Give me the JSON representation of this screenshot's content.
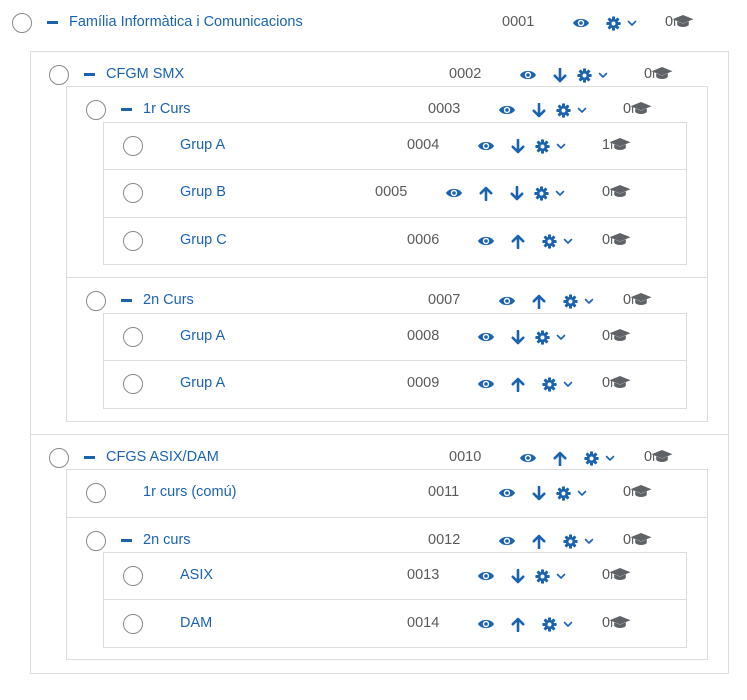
{
  "colors": {
    "accent": "#1a63b0",
    "muted_icon": "#5f6368",
    "border": "#dcdcdc"
  },
  "rows": [
    {
      "name": "Família Informàtica i Comunicacions",
      "code": "0001",
      "count": "0",
      "toggle": "collapse",
      "actions": [
        "eye-icon",
        "gear-icon",
        "chevron-down-icon"
      ]
    },
    {
      "name": "CFGM SMX",
      "code": "0002",
      "count": "0",
      "toggle": "collapse",
      "actions": [
        "eye-icon",
        "arrow-down-icon",
        "gear-icon",
        "chevron-down-icon"
      ]
    },
    {
      "name": "1r Curs",
      "code": "0003",
      "count": "0",
      "toggle": "collapse",
      "actions": [
        "eye-icon",
        "arrow-down-icon",
        "gear-icon",
        "chevron-down-icon"
      ]
    },
    {
      "name": "Grup A",
      "code": "0004",
      "count": "1",
      "actions": [
        "eye-icon",
        "arrow-down-icon",
        "gear-icon",
        "chevron-down-icon"
      ]
    },
    {
      "name": "Grup B",
      "code": "0005",
      "count": "0",
      "actions": [
        "eye-icon",
        "arrow-up-icon",
        "arrow-down-icon",
        "gear-icon",
        "chevron-down-icon"
      ]
    },
    {
      "name": "Grup C",
      "code": "0006",
      "count": "0",
      "actions": [
        "eye-icon",
        "arrow-up-icon",
        "gear-icon",
        "chevron-down-icon"
      ]
    },
    {
      "name": "2n Curs",
      "code": "0007",
      "count": "0",
      "toggle": "collapse",
      "actions": [
        "eye-icon",
        "arrow-up-icon",
        "gear-icon",
        "chevron-down-icon"
      ]
    },
    {
      "name": "Grup A",
      "code": "0008",
      "count": "0",
      "actions": [
        "eye-icon",
        "arrow-down-icon",
        "gear-icon",
        "chevron-down-icon"
      ]
    },
    {
      "name": "Grup A",
      "code": "0009",
      "count": "0",
      "actions": [
        "eye-icon",
        "arrow-up-icon",
        "gear-icon",
        "chevron-down-icon"
      ]
    },
    {
      "name": "CFGS ASIX/DAM",
      "code": "0010",
      "count": "0",
      "toggle": "collapse",
      "actions": [
        "eye-icon",
        "arrow-up-icon",
        "gear-icon",
        "chevron-down-icon"
      ]
    },
    {
      "name": "1r curs (comú)",
      "code": "0011",
      "count": "0",
      "actions": [
        "eye-icon",
        "arrow-down-icon",
        "gear-icon",
        "chevron-down-icon"
      ]
    },
    {
      "name": "2n curs",
      "code": "0012",
      "count": "0",
      "toggle": "collapse",
      "actions": [
        "eye-icon",
        "arrow-up-icon",
        "gear-icon",
        "chevron-down-icon"
      ]
    },
    {
      "name": "ASIX",
      "code": "0013",
      "count": "0",
      "actions": [
        "eye-icon",
        "arrow-down-icon",
        "gear-icon",
        "chevron-down-icon"
      ]
    },
    {
      "name": "DAM",
      "code": "0014",
      "count": "0",
      "actions": [
        "eye-icon",
        "arrow-up-icon",
        "gear-icon",
        "chevron-down-icon"
      ]
    }
  ]
}
